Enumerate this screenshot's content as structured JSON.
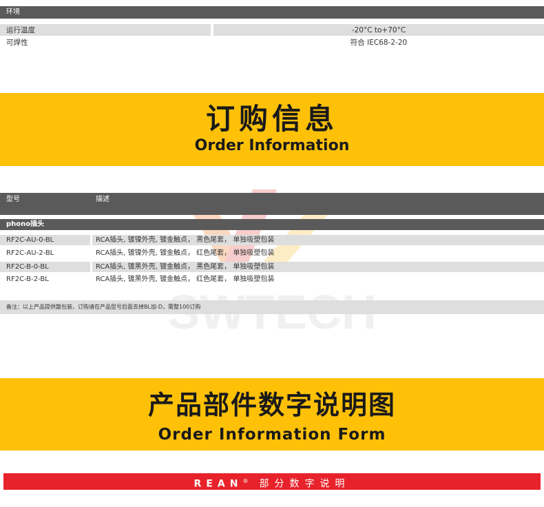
{
  "env": {
    "header": "环境",
    "rows": [
      {
        "label": "运行温度",
        "value": "-20°C to+70°C"
      },
      {
        "label": "可焊性",
        "value": "符合 IEC68-2-20"
      }
    ]
  },
  "order_banner": {
    "title_cn": "订购信息",
    "title_en": "Order Information"
  },
  "order_table": {
    "col_model": "型号",
    "col_desc": "描述",
    "group": "phono插头",
    "rows": [
      {
        "model": "RF2C-AU-0-BL",
        "desc": "RCA插头, 镀镍外壳, 镀金触点， 黑色尾套， 单独吸塑包装"
      },
      {
        "model": "RF2C-AU-2-BL",
        "desc": "RCA插头, 镀镍外壳, 镀金触点， 红色尾套， 单独吸塑包装"
      },
      {
        "model": "RF2C-B-0-BL",
        "desc": "RCA插头, 镀黑外壳, 镀金触点， 黑色尾套， 单独吸塑包装"
      },
      {
        "model": "RF2C-B-2-BL",
        "desc": "RCA插头, 镀黑外壳, 镀金触点， 红色尾套， 单独吸塑包装"
      }
    ],
    "note": "备注：以上产品提供散包装，订购请在产品型号后面去掉BL加-D，需整100订购"
  },
  "watermark": {
    "text": "SWTECH"
  },
  "form_banner": {
    "title_cn": "产品部件数字说明图",
    "title_en": "Order Information Form"
  },
  "red_bar": {
    "brand": "REAN",
    "reg": "®",
    "text": "部分数字说明"
  },
  "colors": {
    "yellow": "#fec108",
    "dark_bar": "#5a5a5a",
    "grey_cell": "#dedede",
    "red": "#e8222b"
  }
}
